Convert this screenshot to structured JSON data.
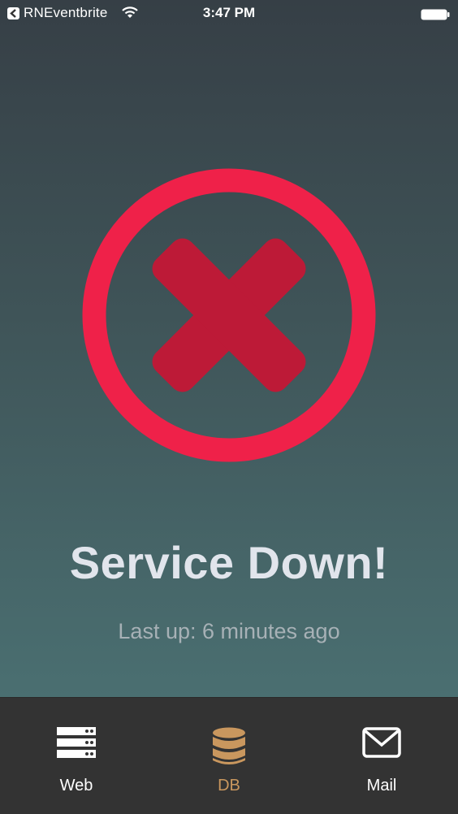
{
  "status_bar": {
    "app_name": "RNEventbrite",
    "time": "3:47 PM"
  },
  "main": {
    "status_icon": "x-circle-icon",
    "headline": "Service Down!",
    "last_up": "Last up: 6 minutes ago"
  },
  "tabs": [
    {
      "label": "Web",
      "icon": "server-icon",
      "active": false
    },
    {
      "label": "DB",
      "icon": "database-icon",
      "active": true
    },
    {
      "label": "Mail",
      "icon": "mail-icon",
      "active": false
    }
  ],
  "colors": {
    "ring": "#ef2149",
    "cross": "#bd1a37",
    "active_tab": "#c9975e",
    "tab_bar": "#333333"
  }
}
